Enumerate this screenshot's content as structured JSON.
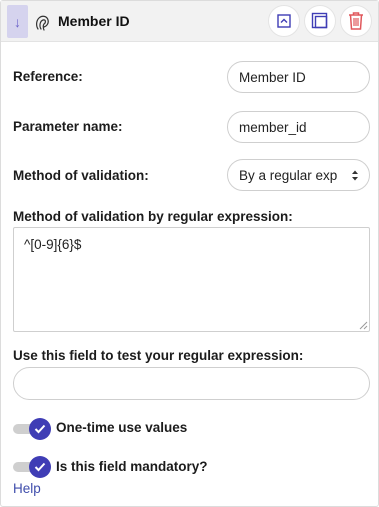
{
  "header": {
    "title": "Member ID",
    "drag_icon": "arrow-down-icon",
    "type_icon": "fingerprint-icon",
    "buttons": [
      "collapse-up-icon",
      "duplicate-icon",
      "trash-icon"
    ],
    "accent_color": "#3f3db5",
    "delete_color": "#e0575b"
  },
  "fields": {
    "reference": {
      "label": "Reference:",
      "value": "Member ID"
    },
    "parameter_name": {
      "label": "Parameter name:",
      "value": "member_id"
    },
    "validation_method": {
      "label": "Method of validation:",
      "selected": "By a regular exp"
    },
    "regex": {
      "label": "Method of validation by regular expression:",
      "value": "^[0-9]{6}$"
    },
    "test": {
      "label": "Use this field to test your regular expression:",
      "value": ""
    }
  },
  "toggles": {
    "one_time": {
      "label": "One-time use values",
      "checked": true
    },
    "mandatory": {
      "label": "Is this field mandatory?",
      "checked": true
    }
  },
  "help_link": "Help"
}
